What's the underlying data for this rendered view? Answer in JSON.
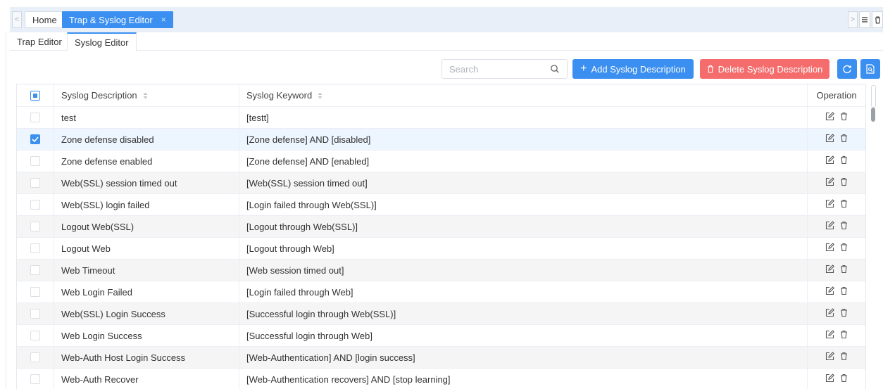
{
  "topbar": {
    "left_arrow": "<",
    "right_arrow": ">",
    "home_tab": "Home",
    "active_tab": "Trap & Syslog Editor",
    "close_glyph": "×"
  },
  "subtabs": [
    "Trap Editor",
    "Syslog Editor"
  ],
  "toolbar": {
    "search_placeholder": "Search",
    "add_label": "Add Syslog Description",
    "add_glyph": "+",
    "delete_label": "Delete Syslog Description"
  },
  "colors": {
    "primary": "#3b8ff0",
    "danger": "#f56c6c",
    "row_alt": "#f5f5f6",
    "row_selected": "#edf5fe"
  },
  "table": {
    "headers": {
      "description": "Syslog Description",
      "keyword": "Syslog Keyword",
      "operation": "Operation"
    },
    "rows": [
      {
        "description": "test",
        "keyword": "[testt]",
        "checked": false
      },
      {
        "description": "Zone defense disabled",
        "keyword": "[Zone defense] AND [disabled]",
        "checked": true
      },
      {
        "description": "Zone defense enabled",
        "keyword": "[Zone defense] AND [enabled]",
        "checked": false
      },
      {
        "description": "Web(SSL) session timed out",
        "keyword": "[Web(SSL) session timed out]",
        "checked": false
      },
      {
        "description": "Web(SSL) login failed",
        "keyword": "[Login failed through Web(SSL)]",
        "checked": false
      },
      {
        "description": "Logout Web(SSL)",
        "keyword": "[Logout through Web(SSL)]",
        "checked": false
      },
      {
        "description": "Logout Web",
        "keyword": "[Logout through Web]",
        "checked": false
      },
      {
        "description": "Web Timeout",
        "keyword": "[Web session timed out]",
        "checked": false
      },
      {
        "description": "Web Login Failed",
        "keyword": "[Login failed through Web]",
        "checked": false
      },
      {
        "description": "Web(SSL) Login Success",
        "keyword": "[Successful login through Web(SSL)]",
        "checked": false
      },
      {
        "description": "Web Login Success",
        "keyword": "[Successful login through Web]",
        "checked": false
      },
      {
        "description": "Web-Auth Host Login Success",
        "keyword": "[Web-Authentication] AND [login success]",
        "checked": false
      },
      {
        "description": "Web-Auth Recover",
        "keyword": "[Web-Authentication recovers] AND [stop learning]",
        "checked": false
      }
    ]
  }
}
